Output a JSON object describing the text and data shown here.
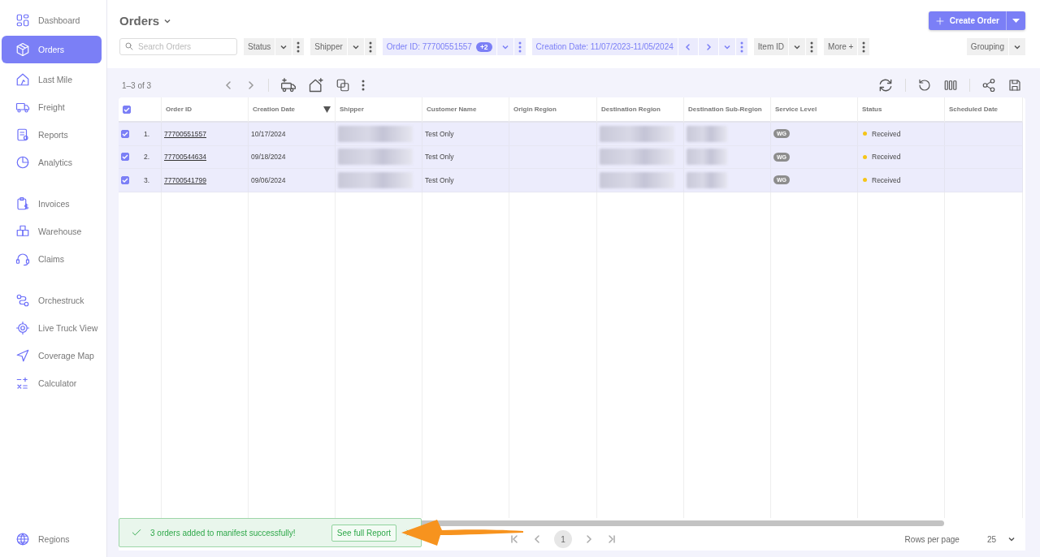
{
  "sidebar": {
    "sections": [
      [
        {
          "label": "Dashboard",
          "selected": false
        },
        {
          "label": "Orders",
          "selected": true
        },
        {
          "label": "Last Mile",
          "selected": false
        },
        {
          "label": "Freight",
          "selected": false
        },
        {
          "label": "Reports",
          "selected": false
        },
        {
          "label": "Analytics",
          "selected": false
        }
      ],
      [
        {
          "label": "Invoices",
          "selected": false
        },
        {
          "label": "Warehouse",
          "selected": false
        },
        {
          "label": "Claims",
          "selected": false
        }
      ],
      [
        {
          "label": "Orchestruck",
          "selected": false
        },
        {
          "label": "Live Truck View",
          "selected": false
        },
        {
          "label": "Coverage Map",
          "selected": false
        },
        {
          "label": "Calculator",
          "selected": false
        }
      ]
    ],
    "footer_item": {
      "label": "Regions",
      "selected": false
    }
  },
  "page": {
    "title": "Orders",
    "create_button": "Create Order"
  },
  "search": {
    "placeholder": "Search Orders"
  },
  "filters": [
    {
      "kind": "dropdown",
      "label": "Status",
      "active": false
    },
    {
      "kind": "dropdown",
      "label": "Shipper",
      "active": false
    },
    {
      "kind": "dropdown",
      "label": "Order ID: 77700551557",
      "badge": "+2",
      "active": true
    },
    {
      "kind": "date",
      "label": "Creation Date: 11/07/2023-11/05/2024",
      "active": true
    },
    {
      "kind": "dropdown",
      "label": "Item ID",
      "active": false
    },
    {
      "kind": "more",
      "label": "More +",
      "active": false
    }
  ],
  "grouping": "Grouping",
  "grid": {
    "range": "1–3 of 3",
    "all_selected": true,
    "columns": [
      {
        "label": "Order ID",
        "sorted": false
      },
      {
        "label": "Creation Date",
        "sorted": true
      },
      {
        "label": "Shipper",
        "sorted": false
      },
      {
        "label": "Customer Name",
        "sorted": false
      },
      {
        "label": "Origin Region",
        "sorted": false
      },
      {
        "label": "Destination Region",
        "sorted": false
      },
      {
        "label": "Destination Sub-Region",
        "sorted": false
      },
      {
        "label": "Service Level",
        "sorted": false
      },
      {
        "label": "Status",
        "sorted": false
      },
      {
        "label": "Scheduled Date",
        "sorted": false
      }
    ],
    "rows": [
      {
        "selected": true,
        "number": "1.",
        "order_id": "77700551557",
        "creation_date": "10/17/2024",
        "customer": "Test Only",
        "service": "WG",
        "status": "Received",
        "color": "#f5c518"
      },
      {
        "selected": true,
        "number": "2.",
        "order_id": "77700544634",
        "creation_date": "09/18/2024",
        "customer": "Test Only",
        "service": "WG",
        "status": "Received",
        "color": "#f5c518"
      },
      {
        "selected": true,
        "number": "3.",
        "order_id": "77700541799",
        "creation_date": "09/06/2024",
        "customer": "Test Only",
        "service": "WG",
        "status": "Received",
        "color": "#f5c518"
      }
    ]
  },
  "pagination": {
    "pages": [
      {
        "label": "1",
        "selected": true
      }
    ],
    "rows_per_page_label": "Rows per page",
    "rows_per_page": "25"
  },
  "toast": {
    "message": "3 orders added to manifest successfully!",
    "action": "See full Report"
  }
}
